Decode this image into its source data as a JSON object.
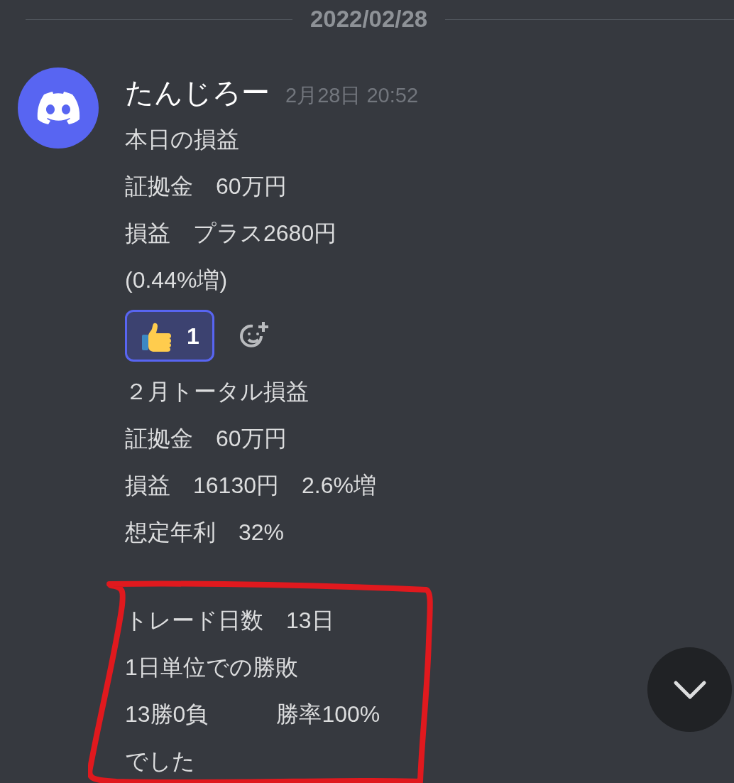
{
  "date_divider": "2022/02/28",
  "messages": [
    {
      "author": "たんじろー",
      "timestamp": "2月28日 20:52",
      "groups": [
        {
          "highlighted": false,
          "lines": [
            "本日の損益",
            "証拠金　60万円",
            "損益　プラス2680円",
            "(0.44%増)"
          ]
        }
      ],
      "reactions": [
        {
          "count": "1",
          "selected": true
        }
      ]
    },
    {
      "groups": [
        {
          "highlighted": false,
          "lines": [
            "２月トータル損益",
            "証拠金　60万円",
            "損益　16130円　2.6%増",
            "想定年利　32%"
          ]
        },
        {
          "highlighted": true,
          "lines": [
            "トレード日数　13日",
            "1日単位での勝敗",
            "13勝0負　　　勝率100%",
            "でした"
          ]
        }
      ]
    }
  ]
}
